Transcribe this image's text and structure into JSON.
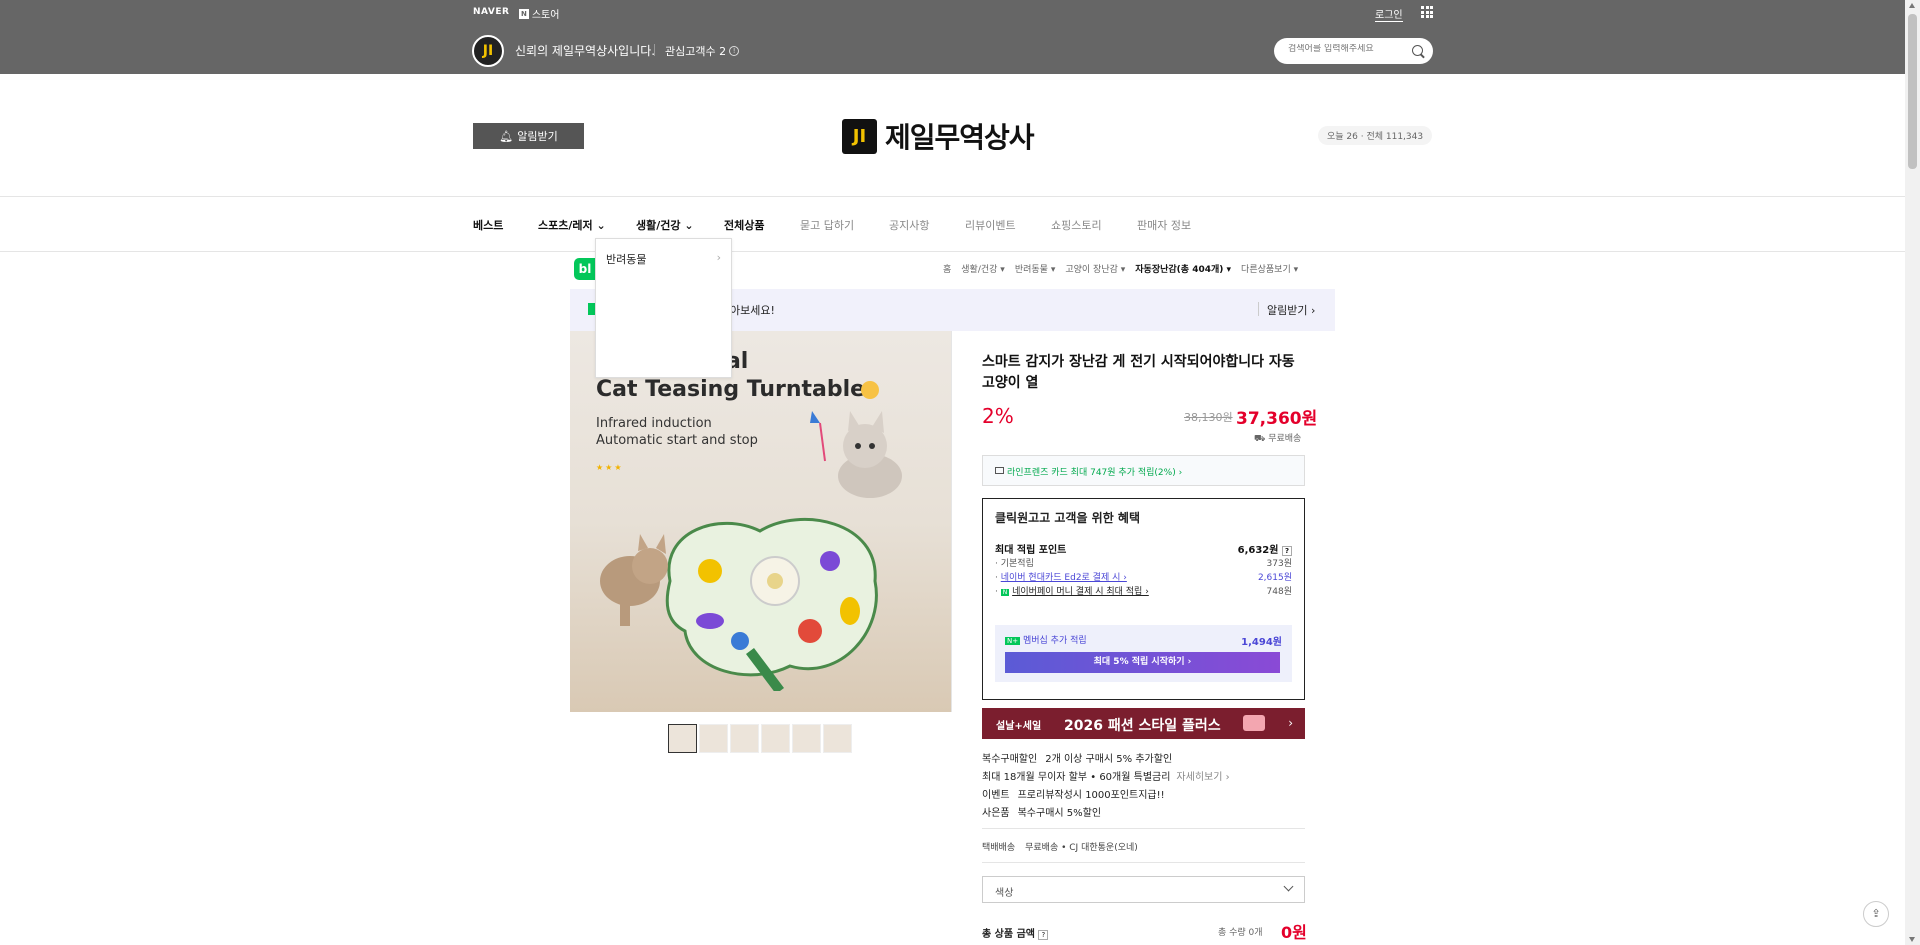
{
  "topbar": {
    "naver": "NAVER",
    "nstore_box": "N",
    "nstore_label": "스토어",
    "login": "로그인",
    "logo_text": "JI",
    "slogan": "신뢰의 제일무역상사입니다.",
    "fans": "관심고객수 2",
    "search_placeholder": "검색어를 입력해주세요"
  },
  "header": {
    "alarm_button": "알림받기",
    "brand_logo": "JI",
    "brand_name": "제일무역상사",
    "visitors": "오늘 26 · 전체 111,343"
  },
  "nav": {
    "items": [
      "베스트",
      "스포츠/레저",
      "생활/건강",
      "전체상품",
      "묻고 답하기",
      "공지사항",
      "리뷰이벤트",
      "쇼핑스토리",
      "판매자 정보"
    ]
  },
  "dropdown": {
    "item": "반려동물"
  },
  "breadcrumb": {
    "items": [
      "홈",
      "생활/건강",
      "반려동물",
      "고양이 장난감",
      "자동장난감(총 404개)",
      "다른상품보기"
    ]
  },
  "notice_bar": {
    "text": "아보세요!",
    "badge": "N",
    "alarm": "알림받기"
  },
  "product_image": {
    "line1": "ti-functional",
    "line2": "Cat Teasing Turntable",
    "sub1": "Infrared induction",
    "sub2": "Automatic start and stop",
    "stars": "★★★"
  },
  "product": {
    "title": "스마트 감지가 장난감 게 전기 시작되어야합니다 자동 고양이 열",
    "discount": "2%",
    "original_price": "38,130원",
    "sale_price": "37,360원",
    "shipping": "무료배송",
    "card_benefit": "라인프렌즈 카드 최대 747원 추가 적립(2%) ›"
  },
  "benefit": {
    "title": "클릭원고고 고객을 위한 혜택",
    "max_points_label": "최대 적립 포인트",
    "max_points_value": "6,632원",
    "basic_label": "기본적립",
    "basic_value": "373원",
    "hyundai_label": "네이버 현대카드 Ed2로 결제 시 ›",
    "hyundai_value": "2,615원",
    "npay_label": "네이버페이 머니 결제 시 최대 적립 ›",
    "npay_value": "748원",
    "membership_label": "멤버십 추가 적립",
    "membership_value": "1,494원",
    "membership_button": "최대 5% 적립 시작하기 ›"
  },
  "banner": {
    "tag": "설날+세일",
    "text": "2026 패션 스타일 플러스",
    "arrow": "›"
  },
  "promos": [
    {
      "key": "복수구매할인",
      "value": "2개 이상 구매시 5% 추가할인",
      "more": ""
    },
    {
      "key": "최대 18개월 무이자 할부 • 60개월 특별금리",
      "value": "",
      "more": "자세히보기 ›"
    },
    {
      "key": "이벤트",
      "value": "프로리뷰작성시 1000포인트지급!!",
      "more": ""
    },
    {
      "key": "사은품",
      "value": "복수구매시 5%할인",
      "more": ""
    }
  ],
  "shipping_info": {
    "label": "택배배송",
    "value": "무료배송 • CJ 대한통운(오네)"
  },
  "option": {
    "placeholder": "색상"
  },
  "total": {
    "label": "총 상품 금액",
    "qty": "총 수량 0개",
    "price": "0원"
  }
}
